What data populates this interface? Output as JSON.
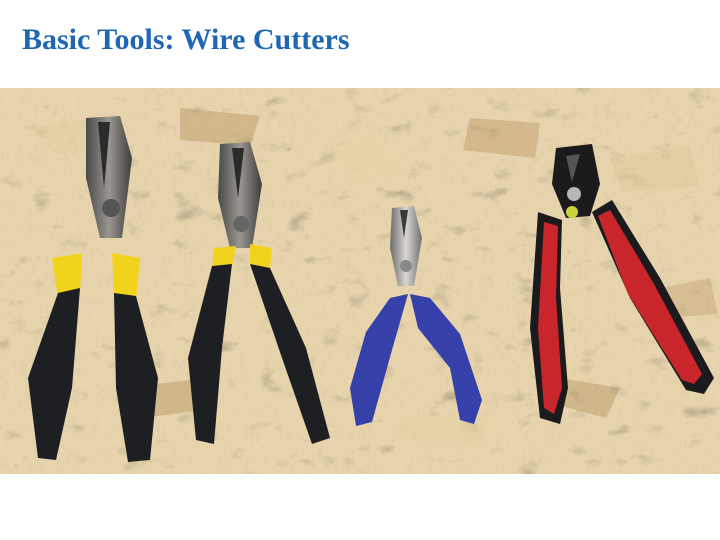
{
  "slide": {
    "title": "Basic Tools: Wire Cutters"
  },
  "photo": {
    "subject": "four-wire-cutters-on-osb-board",
    "tools": [
      {
        "name": "large-diagonal-cutter",
        "handle_color": "#1d1f22",
        "grip_accent": "#f1d21c"
      },
      {
        "name": "medium-diagonal-cutter",
        "handle_color": "#1d1f22",
        "grip_accent": "#f1d21c"
      },
      {
        "name": "small-flush-cutter",
        "handle_color": "#3540a8"
      },
      {
        "name": "precision-flush-cutter",
        "handle_color": "#c9262b",
        "grip_accent": "#1b1b1d"
      }
    ]
  },
  "colors": {
    "title": "#1f67b5",
    "board": "#c9a86d",
    "background": "#ffffff"
  }
}
